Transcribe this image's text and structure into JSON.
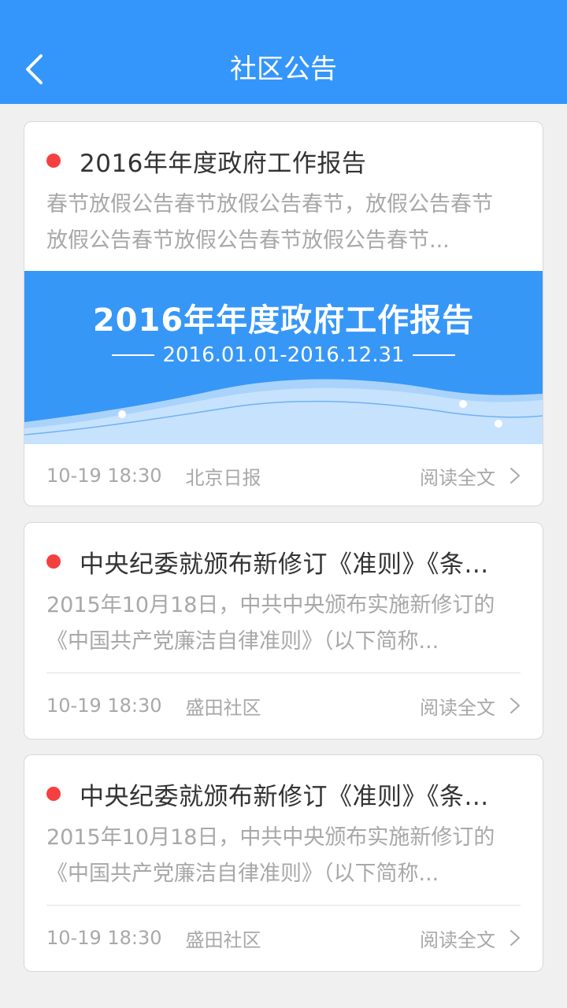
{
  "header": {
    "title": "社区公告"
  },
  "notices": [
    {
      "title": "2016年年度政府工作报告",
      "summary_lines": [
        "春节放假公告春节放假公告春节，放假公告春节",
        "放假公告春节放假公告春节放假公告春节..."
      ],
      "banner": {
        "title": "2016年年度政府工作报告",
        "date_range": "2016.01.01-2016.12.31"
      },
      "time": "10-19 18:30",
      "source": "北京日报",
      "read_more": "阅读全文"
    },
    {
      "title": "中央纪委就颁布新修订《准则》《条...",
      "summary_lines": [
        "2015年10月18日，中共中央颁布实施新修订的",
        "《中国共产党廉洁自律准则》（以下简称..."
      ],
      "time": "10-19 18:30",
      "source": "盛田社区",
      "read_more": "阅读全文"
    },
    {
      "title": "中央纪委就颁布新修订《准则》《条...",
      "summary_lines": [
        "2015年10月18日，中共中央颁布实施新修订的",
        "《中国共产党廉洁自律准则》（以下简称..."
      ],
      "time": "10-19 18:30",
      "source": "盛田社区",
      "read_more": "阅读全文"
    }
  ],
  "icons": {
    "back": "chevron-left-icon",
    "read_more": "chevron-right-icon",
    "unread": "red-dot-indicator"
  },
  "colors": {
    "header_bg": "#3496fa",
    "unread_dot": "#f4413f",
    "banner_bg": "#3797f7"
  }
}
